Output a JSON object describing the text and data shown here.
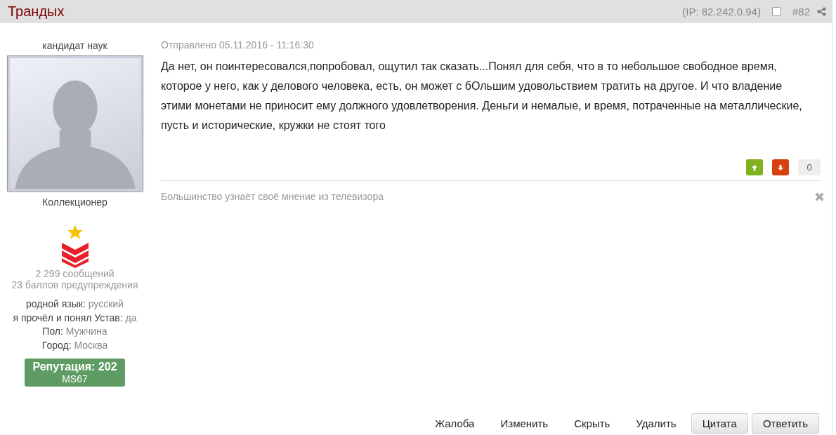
{
  "post": {
    "author": "Трандых",
    "ip": "(IP: 82.242.0.94)",
    "selected": false,
    "number": "#82"
  },
  "profile": {
    "title": "кандидат наук",
    "group": "Коллекционер",
    "posts": "2 299 сообщений",
    "warnings": "23 баллов предупреждения",
    "fields": [
      {
        "label": "родной язык:",
        "value": "русский"
      },
      {
        "label": "я прочёл и понял Устав:",
        "value": "да"
      },
      {
        "label": "Пол:",
        "value": "Мужчина"
      },
      {
        "label": "Город:",
        "value": "Москва"
      }
    ],
    "reputation": "Репутация: 202",
    "grade": "MS67"
  },
  "date": "Отправлено 05.11.2016 - 11:16:30",
  "body": "Да нет, он поинтересовался,попробовал, ощутил так сказать...Понял для себя, что в то небольшое свободное время, которое у него, как у делового человека, есть, он может с бОльшим удовольствием тратить на другое. И что владение этими монетами не приносит ему должного удовлетворения. Деньги и немалые, и время, потраченные на металлические, пусть и исторические, кружки не стоят того",
  "rating": "0",
  "signature": "Большинство узнаёт своё мнение из телевизора",
  "actions": [
    {
      "label": "Жалоба",
      "kind": "link"
    },
    {
      "label": "Изменить",
      "kind": "link"
    },
    {
      "label": "Скрыть",
      "kind": "link"
    },
    {
      "label": "Удалить",
      "kind": "link"
    },
    {
      "label": "Цитата",
      "kind": "button"
    },
    {
      "label": "Ответить",
      "kind": "button"
    }
  ]
}
